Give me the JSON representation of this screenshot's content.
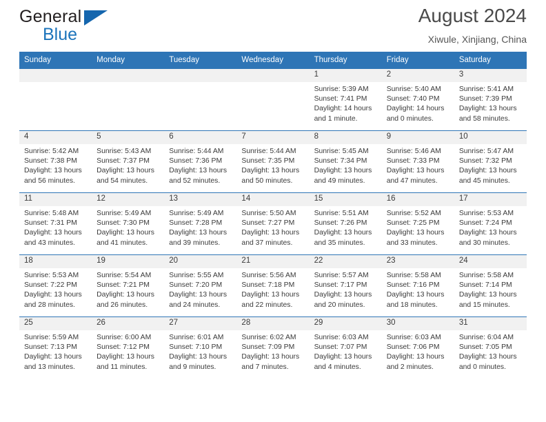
{
  "brand": {
    "name_top": "General",
    "name_bottom": "Blue",
    "triangle_icon": "triangle-icon",
    "color_dark": "#231f20",
    "color_blue": "#1c74bb"
  },
  "header": {
    "title": "August 2024",
    "subtitle": "Xiwule, Xinjiang, China",
    "accent_color": "#2e75b6"
  },
  "calendar": {
    "weekday_headers": [
      "Sunday",
      "Monday",
      "Tuesday",
      "Wednesday",
      "Thursday",
      "Friday",
      "Saturday"
    ],
    "weeks": [
      [
        {
          "day": "",
          "sunrise": "",
          "sunset": "",
          "daylight1": "",
          "daylight2": ""
        },
        {
          "day": "",
          "sunrise": "",
          "sunset": "",
          "daylight1": "",
          "daylight2": ""
        },
        {
          "day": "",
          "sunrise": "",
          "sunset": "",
          "daylight1": "",
          "daylight2": ""
        },
        {
          "day": "",
          "sunrise": "",
          "sunset": "",
          "daylight1": "",
          "daylight2": ""
        },
        {
          "day": "1",
          "sunrise": "Sunrise: 5:39 AM",
          "sunset": "Sunset: 7:41 PM",
          "daylight1": "Daylight: 14 hours",
          "daylight2": "and 1 minute."
        },
        {
          "day": "2",
          "sunrise": "Sunrise: 5:40 AM",
          "sunset": "Sunset: 7:40 PM",
          "daylight1": "Daylight: 14 hours",
          "daylight2": "and 0 minutes."
        },
        {
          "day": "3",
          "sunrise": "Sunrise: 5:41 AM",
          "sunset": "Sunset: 7:39 PM",
          "daylight1": "Daylight: 13 hours",
          "daylight2": "and 58 minutes."
        }
      ],
      [
        {
          "day": "4",
          "sunrise": "Sunrise: 5:42 AM",
          "sunset": "Sunset: 7:38 PM",
          "daylight1": "Daylight: 13 hours",
          "daylight2": "and 56 minutes."
        },
        {
          "day": "5",
          "sunrise": "Sunrise: 5:43 AM",
          "sunset": "Sunset: 7:37 PM",
          "daylight1": "Daylight: 13 hours",
          "daylight2": "and 54 minutes."
        },
        {
          "day": "6",
          "sunrise": "Sunrise: 5:44 AM",
          "sunset": "Sunset: 7:36 PM",
          "daylight1": "Daylight: 13 hours",
          "daylight2": "and 52 minutes."
        },
        {
          "day": "7",
          "sunrise": "Sunrise: 5:44 AM",
          "sunset": "Sunset: 7:35 PM",
          "daylight1": "Daylight: 13 hours",
          "daylight2": "and 50 minutes."
        },
        {
          "day": "8",
          "sunrise": "Sunrise: 5:45 AM",
          "sunset": "Sunset: 7:34 PM",
          "daylight1": "Daylight: 13 hours",
          "daylight2": "and 49 minutes."
        },
        {
          "day": "9",
          "sunrise": "Sunrise: 5:46 AM",
          "sunset": "Sunset: 7:33 PM",
          "daylight1": "Daylight: 13 hours",
          "daylight2": "and 47 minutes."
        },
        {
          "day": "10",
          "sunrise": "Sunrise: 5:47 AM",
          "sunset": "Sunset: 7:32 PM",
          "daylight1": "Daylight: 13 hours",
          "daylight2": "and 45 minutes."
        }
      ],
      [
        {
          "day": "11",
          "sunrise": "Sunrise: 5:48 AM",
          "sunset": "Sunset: 7:31 PM",
          "daylight1": "Daylight: 13 hours",
          "daylight2": "and 43 minutes."
        },
        {
          "day": "12",
          "sunrise": "Sunrise: 5:49 AM",
          "sunset": "Sunset: 7:30 PM",
          "daylight1": "Daylight: 13 hours",
          "daylight2": "and 41 minutes."
        },
        {
          "day": "13",
          "sunrise": "Sunrise: 5:49 AM",
          "sunset": "Sunset: 7:28 PM",
          "daylight1": "Daylight: 13 hours",
          "daylight2": "and 39 minutes."
        },
        {
          "day": "14",
          "sunrise": "Sunrise: 5:50 AM",
          "sunset": "Sunset: 7:27 PM",
          "daylight1": "Daylight: 13 hours",
          "daylight2": "and 37 minutes."
        },
        {
          "day": "15",
          "sunrise": "Sunrise: 5:51 AM",
          "sunset": "Sunset: 7:26 PM",
          "daylight1": "Daylight: 13 hours",
          "daylight2": "and 35 minutes."
        },
        {
          "day": "16",
          "sunrise": "Sunrise: 5:52 AM",
          "sunset": "Sunset: 7:25 PM",
          "daylight1": "Daylight: 13 hours",
          "daylight2": "and 33 minutes."
        },
        {
          "day": "17",
          "sunrise": "Sunrise: 5:53 AM",
          "sunset": "Sunset: 7:24 PM",
          "daylight1": "Daylight: 13 hours",
          "daylight2": "and 30 minutes."
        }
      ],
      [
        {
          "day": "18",
          "sunrise": "Sunrise: 5:53 AM",
          "sunset": "Sunset: 7:22 PM",
          "daylight1": "Daylight: 13 hours",
          "daylight2": "and 28 minutes."
        },
        {
          "day": "19",
          "sunrise": "Sunrise: 5:54 AM",
          "sunset": "Sunset: 7:21 PM",
          "daylight1": "Daylight: 13 hours",
          "daylight2": "and 26 minutes."
        },
        {
          "day": "20",
          "sunrise": "Sunrise: 5:55 AM",
          "sunset": "Sunset: 7:20 PM",
          "daylight1": "Daylight: 13 hours",
          "daylight2": "and 24 minutes."
        },
        {
          "day": "21",
          "sunrise": "Sunrise: 5:56 AM",
          "sunset": "Sunset: 7:18 PM",
          "daylight1": "Daylight: 13 hours",
          "daylight2": "and 22 minutes."
        },
        {
          "day": "22",
          "sunrise": "Sunrise: 5:57 AM",
          "sunset": "Sunset: 7:17 PM",
          "daylight1": "Daylight: 13 hours",
          "daylight2": "and 20 minutes."
        },
        {
          "day": "23",
          "sunrise": "Sunrise: 5:58 AM",
          "sunset": "Sunset: 7:16 PM",
          "daylight1": "Daylight: 13 hours",
          "daylight2": "and 18 minutes."
        },
        {
          "day": "24",
          "sunrise": "Sunrise: 5:58 AM",
          "sunset": "Sunset: 7:14 PM",
          "daylight1": "Daylight: 13 hours",
          "daylight2": "and 15 minutes."
        }
      ],
      [
        {
          "day": "25",
          "sunrise": "Sunrise: 5:59 AM",
          "sunset": "Sunset: 7:13 PM",
          "daylight1": "Daylight: 13 hours",
          "daylight2": "and 13 minutes."
        },
        {
          "day": "26",
          "sunrise": "Sunrise: 6:00 AM",
          "sunset": "Sunset: 7:12 PM",
          "daylight1": "Daylight: 13 hours",
          "daylight2": "and 11 minutes."
        },
        {
          "day": "27",
          "sunrise": "Sunrise: 6:01 AM",
          "sunset": "Sunset: 7:10 PM",
          "daylight1": "Daylight: 13 hours",
          "daylight2": "and 9 minutes."
        },
        {
          "day": "28",
          "sunrise": "Sunrise: 6:02 AM",
          "sunset": "Sunset: 7:09 PM",
          "daylight1": "Daylight: 13 hours",
          "daylight2": "and 7 minutes."
        },
        {
          "day": "29",
          "sunrise": "Sunrise: 6:03 AM",
          "sunset": "Sunset: 7:07 PM",
          "daylight1": "Daylight: 13 hours",
          "daylight2": "and 4 minutes."
        },
        {
          "day": "30",
          "sunrise": "Sunrise: 6:03 AM",
          "sunset": "Sunset: 7:06 PM",
          "daylight1": "Daylight: 13 hours",
          "daylight2": "and 2 minutes."
        },
        {
          "day": "31",
          "sunrise": "Sunrise: 6:04 AM",
          "sunset": "Sunset: 7:05 PM",
          "daylight1": "Daylight: 13 hours",
          "daylight2": "and 0 minutes."
        }
      ]
    ]
  }
}
